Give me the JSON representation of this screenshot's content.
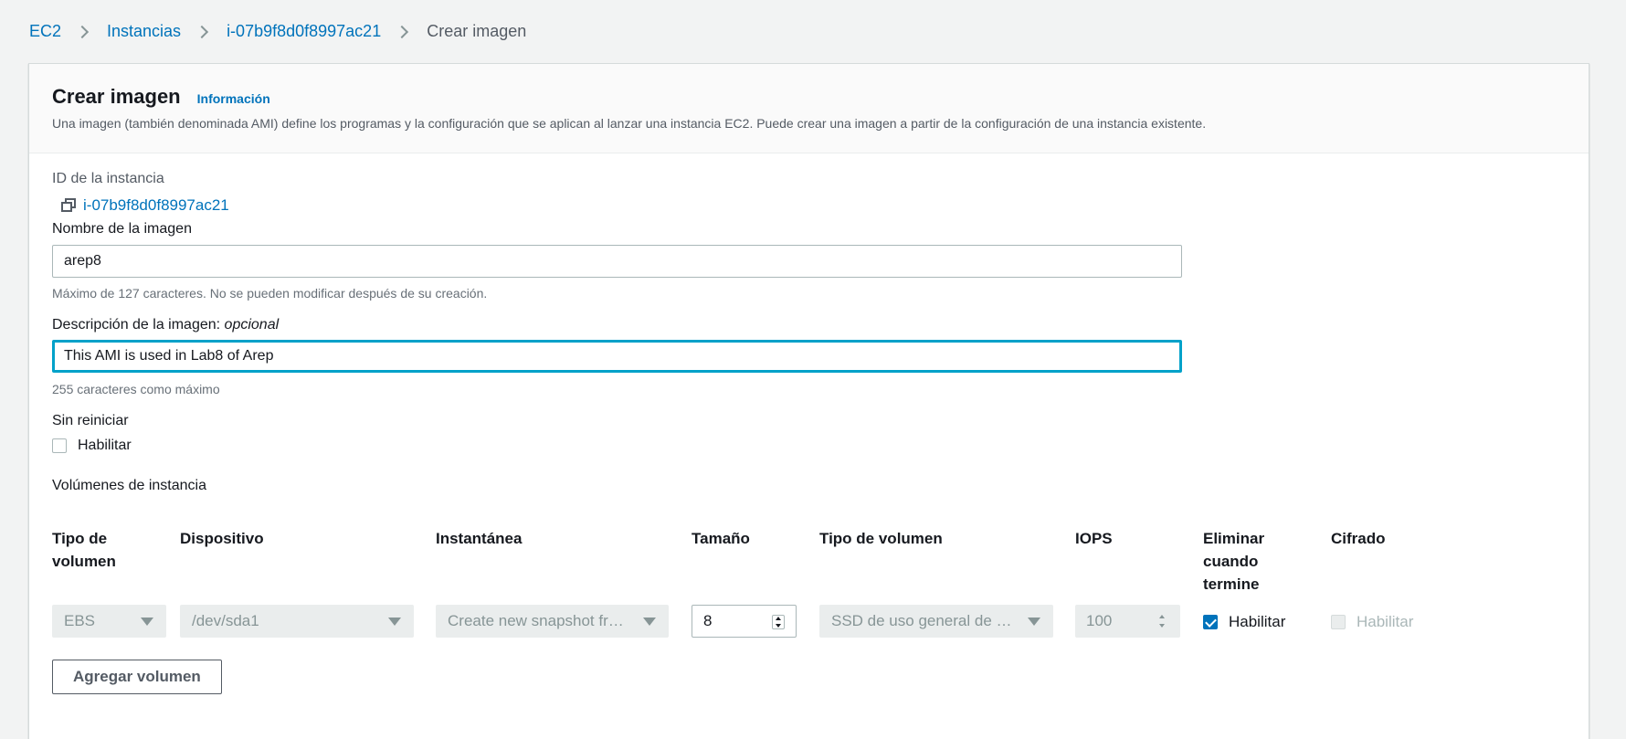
{
  "breadcrumb": {
    "items": [
      "EC2",
      "Instancias",
      "i-07b9f8d0f8997ac21"
    ],
    "current": "Crear imagen"
  },
  "header": {
    "title": "Crear imagen",
    "info_link": "Información",
    "description": "Una imagen (también denominada AMI) define los programas y la configuración que se aplican al lanzar una instancia EC2. Puede crear una imagen a partir de la configuración de una instancia existente."
  },
  "instance": {
    "label": "ID de la instancia",
    "id": "i-07b9f8d0f8997ac21"
  },
  "image_name": {
    "label": "Nombre de la imagen",
    "value": "arep8",
    "hint": "Máximo de 127 caracteres. No se pueden modificar después de su creación."
  },
  "image_description": {
    "label": "Descripción de la imagen:",
    "optional": "opcional",
    "value": "This AMI is used in Lab8 of Arep",
    "hint": "255 caracteres como máximo"
  },
  "no_reboot": {
    "label": "Sin reiniciar",
    "checkbox_label": "Habilitar",
    "checked": false
  },
  "volumes": {
    "title": "Volúmenes de instancia",
    "headers": {
      "volume_type": "Tipo de volumen",
      "device": "Dispositivo",
      "snapshot": "Instantánea",
      "size": "Tamaño",
      "volume_kind": "Tipo de volumen",
      "iops": "IOPS",
      "delete_on_termination": "Eliminar cuando termine",
      "encrypted": "Cifrado"
    },
    "row": {
      "volume_type": "EBS",
      "device": "/dev/sda1",
      "snapshot": "Create new snapshot fr…",
      "size": "8",
      "volume_kind": "SSD de uso general de …",
      "iops": "100",
      "delete_label": "Habilitar",
      "delete_checked": true,
      "encrypted_label": "Habilitar",
      "encrypted_checked": false
    },
    "add_button": "Agregar volumen"
  },
  "colors": {
    "link": "#0073bb",
    "focus": "#00a1c9",
    "disabled_bg": "#eaeded"
  }
}
